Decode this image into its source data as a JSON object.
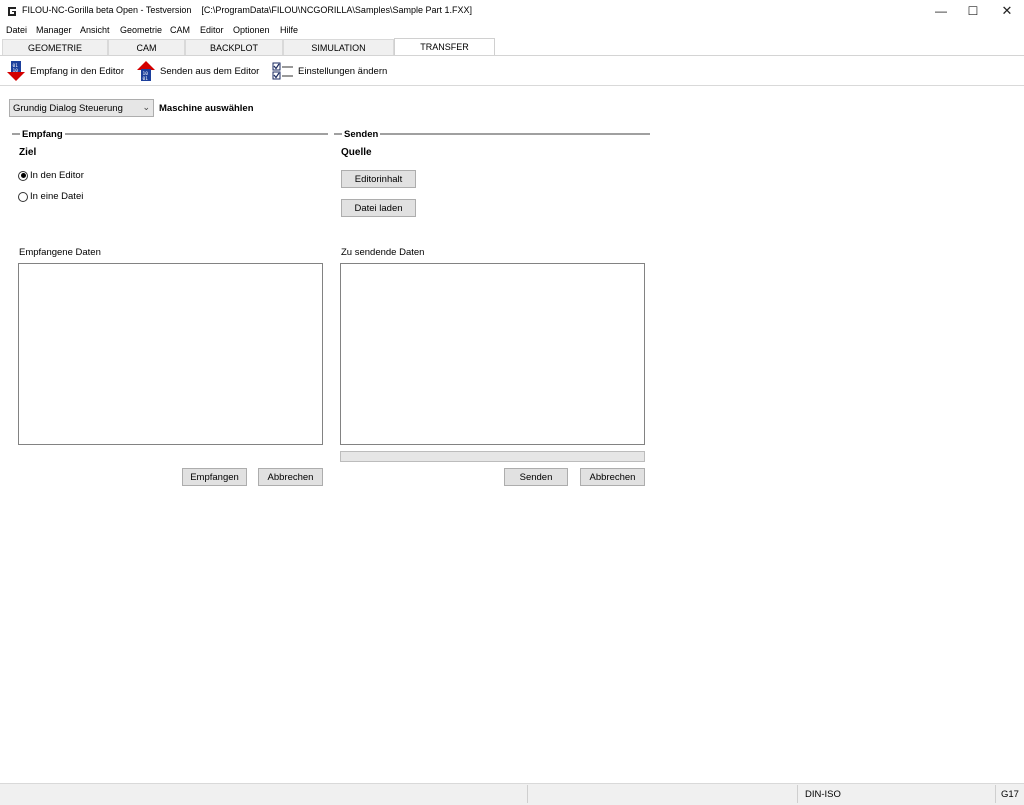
{
  "window": {
    "title": "FILOU-NC-Gorilla beta Open - Testversion    [C:\\ProgramData\\FILOU\\NCGORILLA\\Samples\\Sample Part 1.FXX]",
    "minimize": "—",
    "maximize": "☐",
    "close": "✕"
  },
  "menu": [
    "Datei",
    "Manager",
    "Ansicht",
    "Geometrie",
    "CAM",
    "Editor",
    "Optionen",
    "Hilfe"
  ],
  "tabs": [
    "GEOMETRIE",
    "CAM",
    "BACKPLOT",
    "SIMULATION",
    "TRANSFER"
  ],
  "active_tab": "TRANSFER",
  "toolbar": {
    "receive_label": "Empfang in den Editor",
    "send_label": "Senden aus dem Editor",
    "settings_label": "Einstellungen ändern",
    "receive_icon": "arrow-down-binary-icon",
    "send_icon": "arrow-up-binary-icon",
    "settings_icon": "checklist-icon"
  },
  "machine": {
    "selected": "Grundig Dialog Steuerung",
    "label": "Maschine auswählen"
  },
  "receive": {
    "group_title": "Empfang",
    "target_label": "Ziel",
    "option_editor": "In den Editor",
    "option_file": "In eine Datei",
    "selected_option": "In den Editor",
    "data_label": "Empfangene Daten",
    "data_value": "",
    "receive_button": "Empfangen",
    "cancel_button": "Abbrechen"
  },
  "send": {
    "group_title": "Senden",
    "source_label": "Quelle",
    "editor_content_button": "Editorinhalt",
    "load_file_button": "Datei laden",
    "data_label": "Zu sendende Daten",
    "data_value": "",
    "progress": 0,
    "send_button": "Senden",
    "cancel_button": "Abbrechen"
  },
  "status": {
    "dialect": "DIN-ISO",
    "code": "G17"
  },
  "colors": {
    "arrow_red": "#d40000",
    "arrow_blue": "#1c3f9c",
    "group_line": "#a0a0a0",
    "button_bg": "#e1e1e1"
  }
}
